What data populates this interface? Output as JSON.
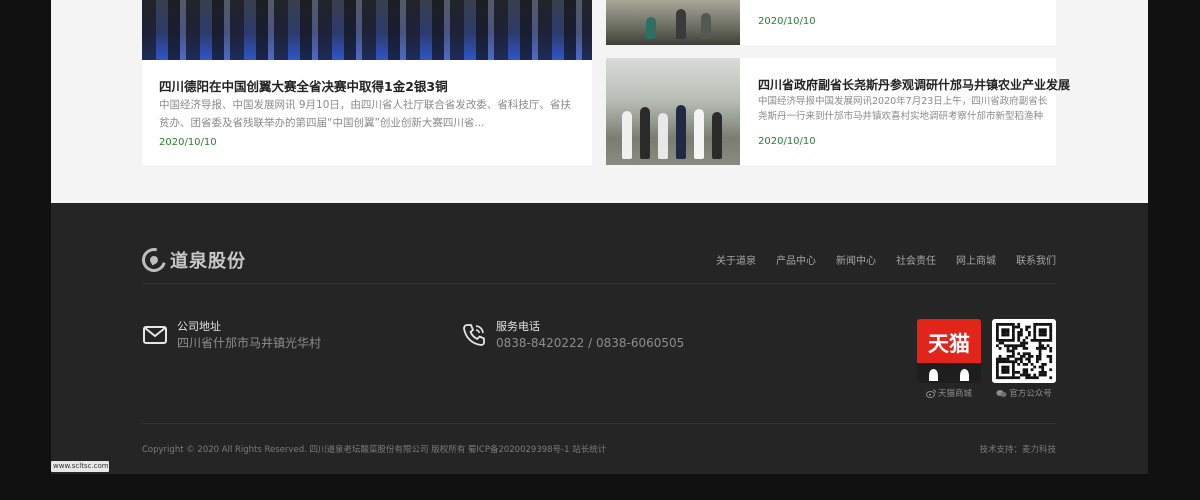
{
  "news": {
    "left": {
      "title": "四川德阳在中国创翼大赛全省决赛中取得1金2银3铜",
      "desc": "中国经济导报、中国发展网讯 9月10日，由四川省人社厅联合省发改委、省科技厅、省扶贫办、团省委及省残联举办的第四届“中国创翼”创业创新大赛四川省...",
      "date": "2020/10/10"
    },
    "right_top": {
      "date": "2020/10/10"
    },
    "right_bottom": {
      "title": "四川省政府副省长尧斯丹参观调研什邡马井镇农业产业发展",
      "desc": "中国经济导报中国发展网讯2020年7月23日上午，四川省政府副省长尧斯丹一行来到什邡市马井镇欢喜村实地调研考察什邡市新型稻渔种",
      "date": "2020/10/10"
    }
  },
  "footer": {
    "logo_text": "道泉股份",
    "nav": [
      "关于道泉",
      "产品中心",
      "新闻中心",
      "社会责任",
      "网上商城",
      "联系我们"
    ],
    "address": {
      "label": "公司地址",
      "value": "四川省什邡市马井镇光华村",
      "icon": "mail-icon"
    },
    "phone": {
      "label": "服务电话",
      "value": "0838-8420222 / 0838-6060505",
      "icon": "phone-icon"
    },
    "tmall": {
      "logo_text": "天猫",
      "caption": "天猫商城"
    },
    "wechat": {
      "caption": "官方公众号"
    },
    "copyright": "Copyright © 2020 All Rights Reserved. 四川道泉老坛酸菜股份有限公司 版权所有 蜀ICP备2020029398号-1 站长统计",
    "support": "技术支持：麦力科技"
  },
  "url_tag": "www.scltsc.com",
  "colors": {
    "date_green": "#2e7d32",
    "footer_bg": "#252525",
    "tmall_red": "#e1251b"
  }
}
